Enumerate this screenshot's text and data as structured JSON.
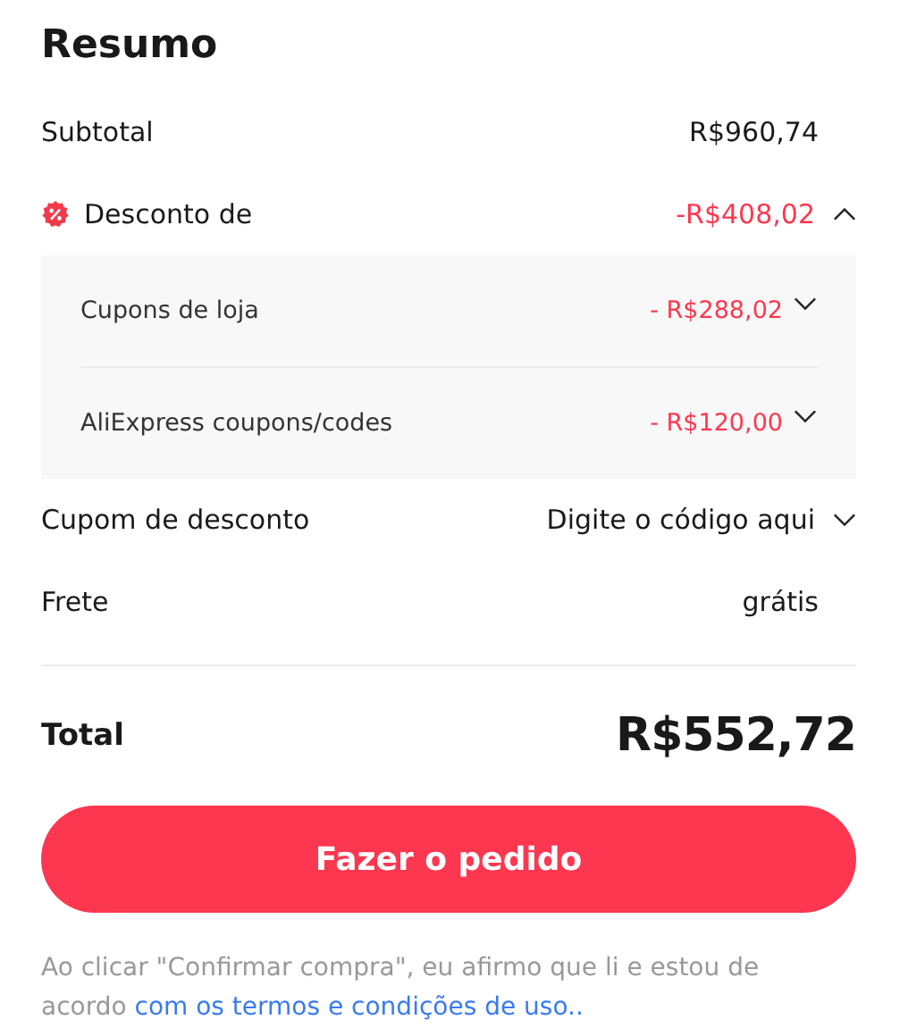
{
  "title": "Resumo",
  "subtotal": {
    "label": "Subtotal",
    "value": "R$960,74"
  },
  "discount": {
    "label": "Desconto de",
    "value": "-R$408,02",
    "expanded": true,
    "items": [
      {
        "label": "Cupons de loja",
        "value": "- R$288,02",
        "expanded": false
      },
      {
        "label": "AliExpress coupons/codes",
        "value": "- R$120,00",
        "expanded": false
      }
    ]
  },
  "coupon": {
    "label": "Cupom de desconto",
    "action": "Digite o código aqui",
    "expanded": false
  },
  "shipping": {
    "label": "Frete",
    "value": "grátis"
  },
  "total": {
    "label": "Total",
    "value": "R$552,72"
  },
  "button": "Fazer o pedido",
  "note": {
    "text": "Ao clicar \"Confirmar compra\", eu afirmo que li e estou de acordo ",
    "link": "com os termos e condições de uso.."
  }
}
